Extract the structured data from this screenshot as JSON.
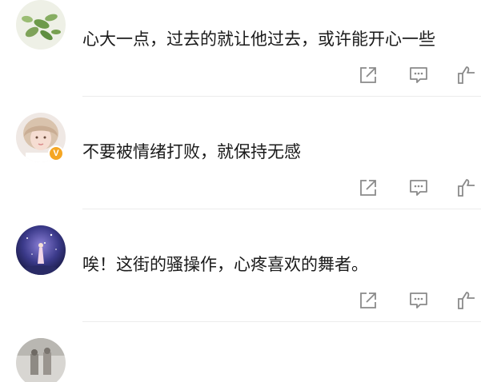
{
  "comments": [
    {
      "text": "心大一点，过去的就让他过去，或许能开心一些",
      "verified": false,
      "verified_badge": ""
    },
    {
      "text": "不要被情绪打败，就保持无感",
      "verified": true,
      "verified_badge": "V"
    },
    {
      "text": "唉！这街的骚操作，心疼喜欢的舞者。",
      "verified": false,
      "verified_badge": ""
    },
    {
      "text": "",
      "verified": false,
      "verified_badge": ""
    }
  ],
  "icons": {
    "share": "share-icon",
    "reply": "comment-icon",
    "like": "thumbs-up-icon"
  },
  "colors": {
    "icon": "#8a8a8a",
    "divider": "#ececec",
    "badge": "#f5a623",
    "text": "#1a1a1a"
  }
}
